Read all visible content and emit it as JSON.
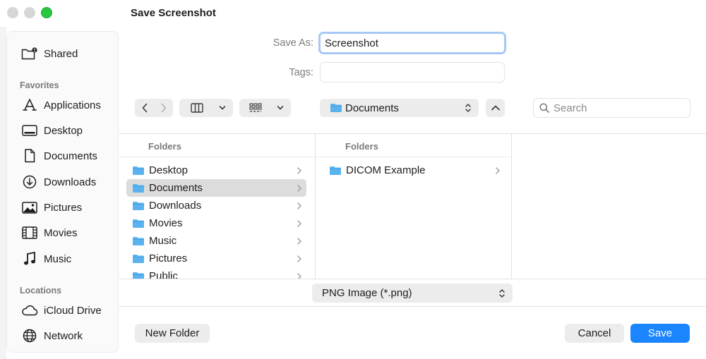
{
  "dialog": {
    "title": "Save Screenshot"
  },
  "colors": {
    "accent": "#1a85ff",
    "folder": "#5ab3ee",
    "selection": "#dcdcdc"
  },
  "sidebar": {
    "shared_label": "Shared",
    "favorites_heading": "Favorites",
    "favorites": [
      {
        "label": "Applications",
        "icon": "applications-icon"
      },
      {
        "label": "Desktop",
        "icon": "desktop-icon"
      },
      {
        "label": "Documents",
        "icon": "document-icon"
      },
      {
        "label": "Downloads",
        "icon": "downloads-icon"
      },
      {
        "label": "Pictures",
        "icon": "pictures-icon"
      },
      {
        "label": "Movies",
        "icon": "movies-icon"
      },
      {
        "label": "Music",
        "icon": "music-icon"
      }
    ],
    "locations_heading": "Locations",
    "locations": [
      {
        "label": "iCloud Drive",
        "icon": "cloud-icon"
      },
      {
        "label": "Network",
        "icon": "globe-icon"
      }
    ]
  },
  "form": {
    "save_as_label": "Save As:",
    "save_as_value": "Screenshot",
    "tags_label": "Tags:",
    "tags_value": ""
  },
  "toolbar": {
    "location": "Documents",
    "search_placeholder": "Search"
  },
  "browser": {
    "columns": [
      {
        "heading": "Folders",
        "items": [
          "Desktop",
          "Documents",
          "Downloads",
          "Movies",
          "Music",
          "Pictures",
          "Public"
        ],
        "selected": "Documents"
      },
      {
        "heading": "Folders",
        "items": [
          "DICOM Example"
        ],
        "selected": ""
      }
    ]
  },
  "format": {
    "value": "PNG Image (*.png)"
  },
  "buttons": {
    "new_folder": "New Folder",
    "cancel": "Cancel",
    "save": "Save"
  }
}
